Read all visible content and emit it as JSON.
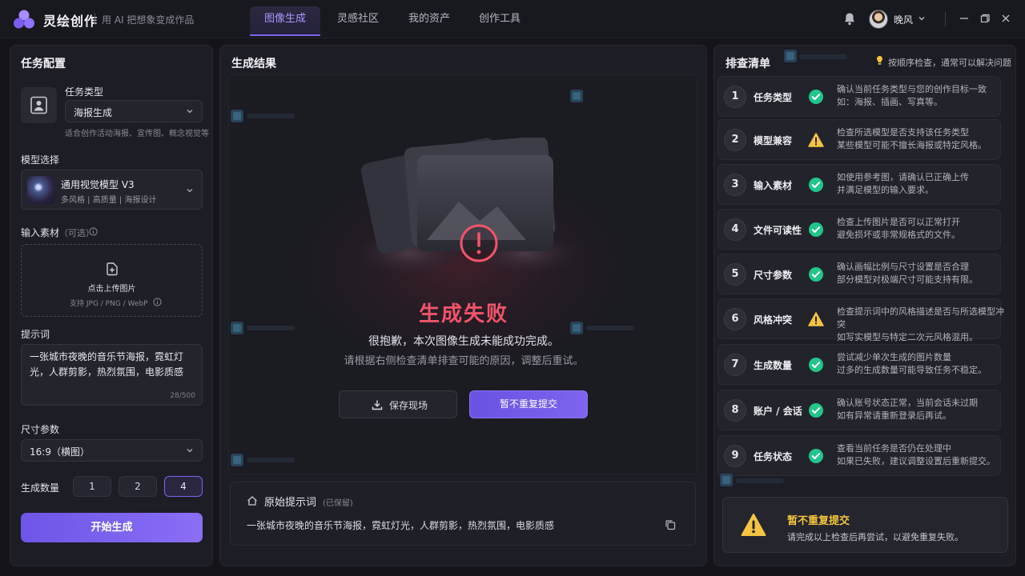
{
  "app": {
    "name": "灵绘创作",
    "slogan": "用 AI 把想象变成作品"
  },
  "nav": {
    "tabs": [
      "图像生成",
      "灵感社区",
      "我的资产",
      "创作工具"
    ],
    "active": "图像生成"
  },
  "user": {
    "name": "晚风"
  },
  "left": {
    "title": "任务配置",
    "task_type": {
      "label": "任务类型",
      "value": "海报生成",
      "hint": "适合创作活动海报、宣传图、概念视觉等"
    },
    "model": {
      "label": "模型选择",
      "name": "通用视觉模型 V3",
      "tags": "多风格 | 高质量 | 海报设计"
    },
    "input": {
      "label": "输入素材",
      "optional": "（可选）",
      "upload_label": "点击上传图片",
      "formats": "支持 JPG / PNG / WebP"
    },
    "prompt": {
      "label": "提示词",
      "text": "一张城市夜晚的音乐节海报，霓虹灯光，人群剪影，热烈氛围，电影质感",
      "count": "28/500"
    },
    "size": {
      "label": "尺寸参数",
      "value": "16:9（横图）"
    },
    "quantity": {
      "label": "生成数量",
      "options": [
        "1",
        "2",
        "4"
      ],
      "selected": "4"
    },
    "start_label": "开始生成"
  },
  "middle": {
    "title": "生成结果",
    "fail_title": "生成失败",
    "fail_line1": "很抱歉，本次图像生成未能成功完成。",
    "fail_line2": "请根据右侧检查清单排查可能的原因，调整后重试。",
    "save_label": "保存现场",
    "no_resubmit_label": "暂不重复提交",
    "original_prompt": {
      "label": "原始提示词",
      "kept": "(已保留)",
      "text": "一张城市夜晚的音乐节海报，霓虹灯光，人群剪影，热烈氛围，电影质感"
    }
  },
  "right": {
    "title": "排查清单",
    "tip": "按顺序检查，通常可以解决问题",
    "items": [
      {
        "num": "1",
        "name": "任务类型",
        "status": "ok",
        "line1": "确认当前任务类型与您的创作目标一致",
        "line2": "如：海报、插画、写真等。"
      },
      {
        "num": "2",
        "name": "模型兼容",
        "status": "warn",
        "line1": "检查所选模型是否支持该任务类型",
        "line2": "某些模型可能不擅长海报或特定风格。"
      },
      {
        "num": "3",
        "name": "输入素材",
        "status": "ok",
        "line1": "如使用参考图，请确认已正确上传",
        "line2": "并满足模型的输入要求。"
      },
      {
        "num": "4",
        "name": "文件可读性",
        "status": "ok",
        "line1": "检查上传图片是否可以正常打开",
        "line2": "避免损坏或非常规格式的文件。"
      },
      {
        "num": "5",
        "name": "尺寸参数",
        "status": "ok",
        "line1": "确认画幅比例与尺寸设置是否合理",
        "line2": "部分模型对极端尺寸可能支持有限。"
      },
      {
        "num": "6",
        "name": "风格冲突",
        "status": "warn",
        "line1": "检查提示词中的风格描述是否与所选模型冲突",
        "line2": "如写实模型与特定二次元风格混用。"
      },
      {
        "num": "7",
        "name": "生成数量",
        "status": "ok",
        "line1": "尝试减少单次生成的图片数量",
        "line2": "过多的生成数量可能导致任务不稳定。"
      },
      {
        "num": "8",
        "name": "账户 / 会话",
        "status": "ok",
        "line1": "确认账号状态正常，当前会话未过期",
        "line2": "如有异常请重新登录后再试。"
      },
      {
        "num": "9",
        "name": "任务状态",
        "status": "ok",
        "line1": "查看当前任务是否仍在处理中",
        "line2": "如果已失败，建议调整设置后重新提交。"
      }
    ],
    "warning": {
      "title": "暂不重复提交",
      "text": "请完成以上检查后再尝试，以避免重复失败。"
    }
  },
  "colors": {
    "accent": "#7c63ee",
    "error": "#f0546a",
    "ok": "#22c58b",
    "warn": "#f4c542"
  }
}
